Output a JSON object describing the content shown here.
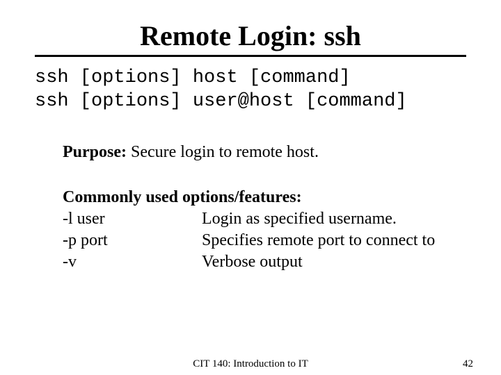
{
  "title": "Remote Login: ssh",
  "syntax": {
    "line1": "ssh [options] host [command]",
    "line2": "ssh [options] user@host [command]"
  },
  "purpose": {
    "label": "Purpose:",
    "text": " Secure login to remote host."
  },
  "options": {
    "heading": "Commonly used options/features:",
    "items": [
      {
        "flag": "-l user",
        "desc": "Login as specified username."
      },
      {
        "flag": "-p port",
        "desc": "Specifies remote port to connect to"
      },
      {
        "flag": "-v",
        "desc": "Verbose output"
      }
    ]
  },
  "footer": {
    "center": "CIT 140: Introduction to IT",
    "page": "42"
  }
}
